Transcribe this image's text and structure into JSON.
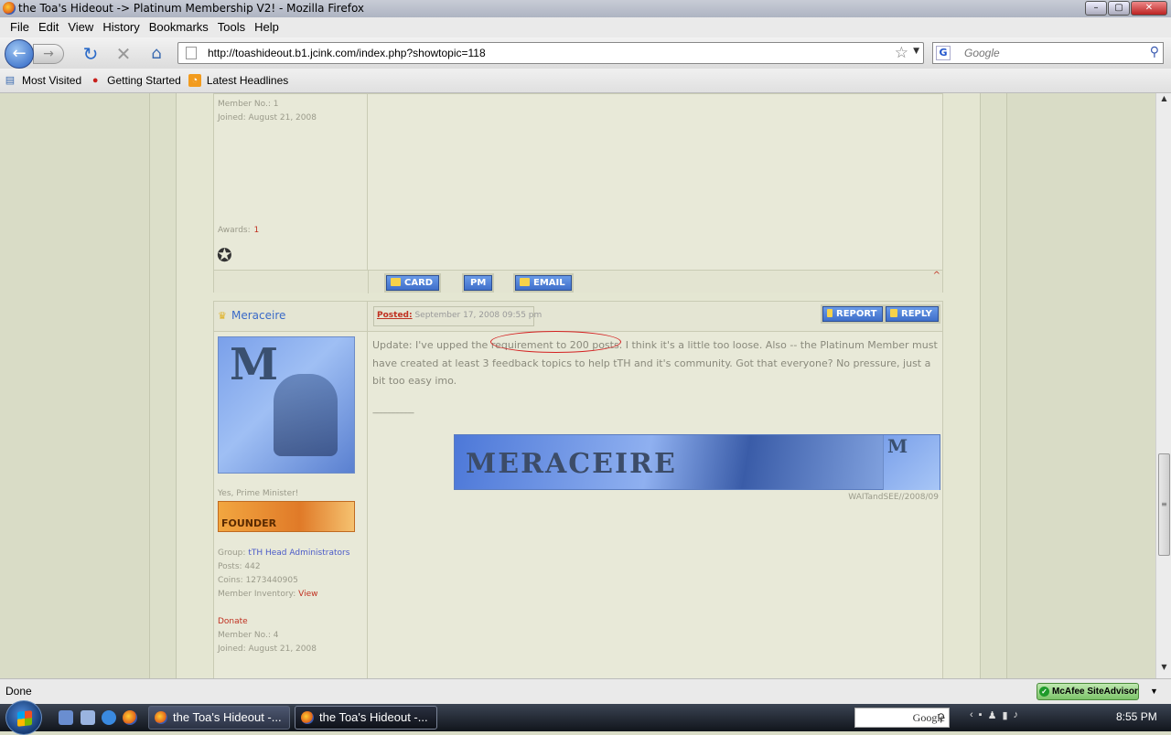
{
  "window": {
    "title": "the Toa's Hideout -> Platinum Membership V2! - Mozilla Firefox",
    "controls": {
      "minimize": "–",
      "maximize": "▢",
      "close": "✕"
    }
  },
  "menu": [
    "File",
    "Edit",
    "View",
    "History",
    "Bookmarks",
    "Tools",
    "Help"
  ],
  "nav": {
    "url": "http://toashideout.b1.jcink.com/index.php?showtopic=118",
    "search_placeholder": "Google"
  },
  "bookmarks": [
    {
      "label": "Most Visited",
      "icon": "bookmark-icon",
      "color": "#3a6ab0"
    },
    {
      "label": "Getting Started",
      "icon": "firefox-logo-icon",
      "color": "#c8201c"
    },
    {
      "label": "Latest Headlines",
      "icon": "rss-icon",
      "color": "#f29b1d"
    }
  ],
  "post1": {
    "member_no": "Member No.: 1",
    "joined": "Joined: August 21, 2008",
    "awards_label": "Awards:",
    "awards_value": "1",
    "buttons": {
      "card": "CARD",
      "pm": "PM",
      "email": "EMAIL"
    },
    "top_marker": "^"
  },
  "post2": {
    "author": "Meraceire",
    "posted_label": "Posted:",
    "posted_date": "September 17, 2008 09:55 pm",
    "report": "REPORT",
    "reply": "REPLY",
    "body": "Update: I've upped the requirement to 200 posts. I think it's a little too loose. Also -- the Platinum Member must have created at least 3 feedback topics to help tTH and it's community. Got that everyone? No pressure, just a bit too easy imo.",
    "separator": "--------------------",
    "signature_banner": "MERACEIRE",
    "signature_credit": "WAITandSEE//2008/09",
    "avatar_letter": "M",
    "member_title": "Yes, Prime Minister!",
    "rank_badge": "FOUNDER",
    "group_label": "Group:",
    "group_value": "tTH Head Administrators",
    "posts": "Posts: 442",
    "coins": "Coins: 1273440905",
    "inventory_label": "Member Inventory:",
    "inventory_link": "View",
    "donate": "Donate",
    "member_no": "Member No.: 4",
    "joined": "Joined: August 21, 2008"
  },
  "status": {
    "text": "Done",
    "siteadvisor": "McAfee SiteAdvisor"
  },
  "taskbar": {
    "tasks": [
      "the Toa's Hideout -...",
      "the Toa's Hideout -..."
    ],
    "search": "Google",
    "clock": "8:55 PM"
  },
  "colors": {
    "link": "#4a5ac8",
    "accent_red": "#c03020",
    "button_blue": "#4f7fd6",
    "page_bg": "#d9dcc6"
  }
}
